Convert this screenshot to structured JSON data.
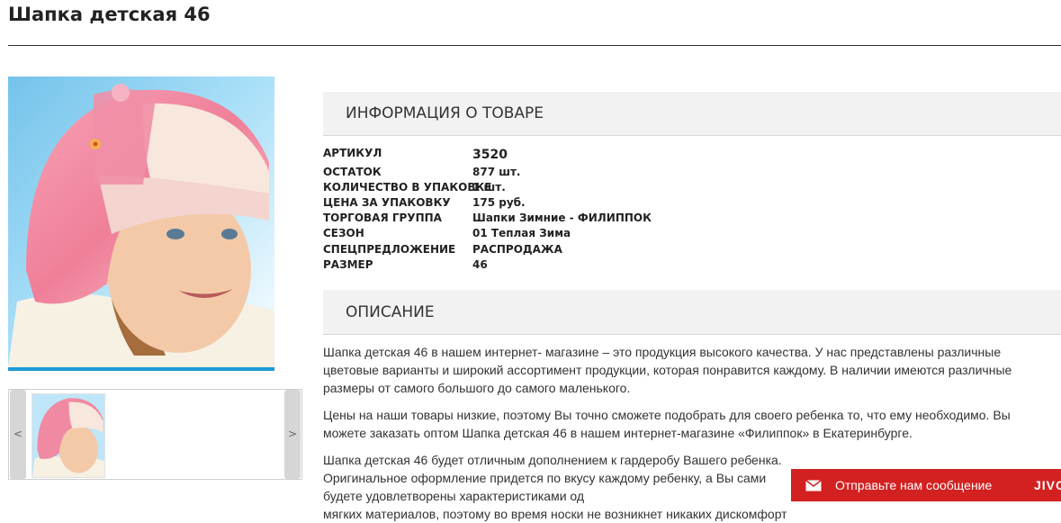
{
  "product": {
    "title": "Шапка детская 46"
  },
  "gallery": {
    "prev_label": "<",
    "next_label": ">"
  },
  "info": {
    "header": "ИНФОРМАЦИЯ О ТОВАРЕ",
    "specs": [
      {
        "label": "АРТИКУЛ",
        "value": "3520"
      },
      {
        "label": "ОСТАТОК",
        "value": "877 шт."
      },
      {
        "label": "КОЛИЧЕСТВО В УПАКОВКЕ",
        "value": "1 шт."
      },
      {
        "label": "ЦЕНА ЗА УПАКОВКУ",
        "value": "175 руб."
      },
      {
        "label": "ТОРГОВАЯ ГРУППА",
        "value": "Шапки Зимние - ФИЛИППОК"
      },
      {
        "label": "СЕЗОН",
        "value": "01 Теплая Зима"
      },
      {
        "label": "СПЕЦПРЕДЛОЖЕНИЕ",
        "value": "РАСПРОДАЖА"
      },
      {
        "label": "РАЗМЕР",
        "value": "46"
      }
    ]
  },
  "description": {
    "header": "ОПИСАНИЕ",
    "paragraphs": [
      "Шапка детская 46 в нашем интернет- магазине – это продукция высокого качества. У нас представлены различные цветовые варианты и широкий ассортимент продукции, которая понравится каждому. В наличии имеются различные размеры от самого большого до самого маленького.",
      "Цены на наши товары низкие, поэтому Вы точно сможете подобрать для своего ребенка то, что ему необходимо. Вы можете заказать оптом Шапка детская 46 в нашем интернет-магазине «Филиппок» в Екатеринбурге.",
      "Шапка детская 46 будет отличным дополнением к гардеробу Вашего ребенка. Оригинальное оформление придется по вкусу каждому ребенку, а Вы сами будете удовлетворены характеристиками од",
      "мягких материалов, поэтому во время носки не возникнет никаких дискомфорт"
    ]
  },
  "chat": {
    "label": "Отправьте нам сообщение",
    "brand": "JIVOSITE"
  },
  "colors": {
    "accent_blue": "#1e9ad6",
    "chat_red": "#d32020"
  }
}
